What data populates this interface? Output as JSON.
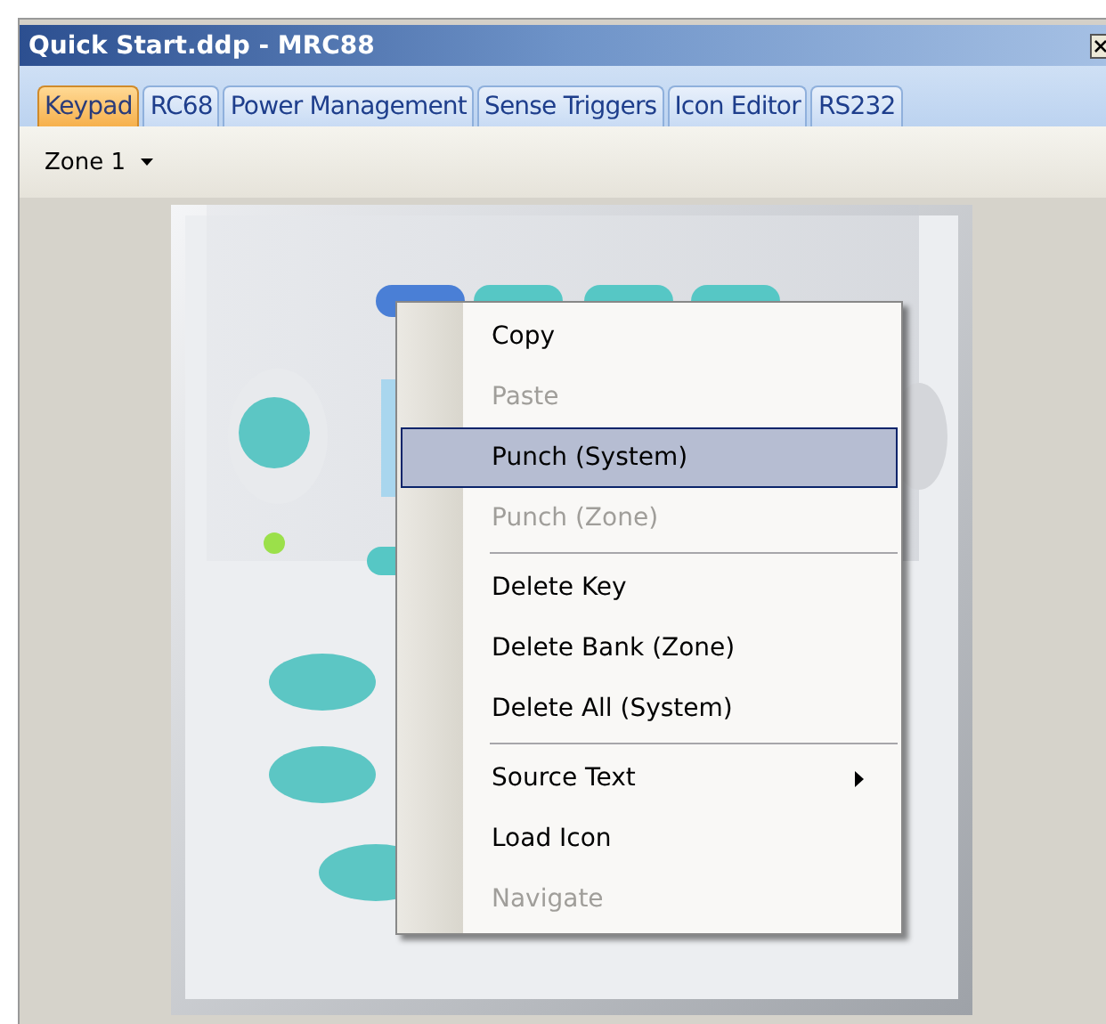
{
  "window": {
    "title": "Quick Start.ddp - MRC88"
  },
  "tabs": [
    {
      "label": "Keypad",
      "selected": true
    },
    {
      "label": "RC68",
      "selected": false
    },
    {
      "label": "Power Management",
      "selected": false
    },
    {
      "label": "Sense Triggers",
      "selected": false
    },
    {
      "label": "Icon Editor",
      "selected": false
    },
    {
      "label": "RS232",
      "selected": false
    }
  ],
  "zone_selector": {
    "value": "Zone 1"
  },
  "context_menu": {
    "items": [
      {
        "kind": "item",
        "label": "Copy",
        "disabled": false,
        "selected": false,
        "submenu": false
      },
      {
        "kind": "item",
        "label": "Paste",
        "disabled": true,
        "selected": false,
        "submenu": false
      },
      {
        "kind": "item",
        "label": "Punch (System)",
        "disabled": false,
        "selected": true,
        "submenu": false
      },
      {
        "kind": "item",
        "label": "Punch (Zone)",
        "disabled": true,
        "selected": false,
        "submenu": false
      },
      {
        "kind": "separator"
      },
      {
        "kind": "item",
        "label": "Delete Key",
        "disabled": false,
        "selected": false,
        "submenu": false
      },
      {
        "kind": "item",
        "label": "Delete Bank (Zone)",
        "disabled": false,
        "selected": false,
        "submenu": false
      },
      {
        "kind": "item",
        "label": "Delete All (System)",
        "disabled": false,
        "selected": false,
        "submenu": false
      },
      {
        "kind": "separator"
      },
      {
        "kind": "item",
        "label": "Source Text",
        "disabled": false,
        "selected": false,
        "submenu": true
      },
      {
        "kind": "item",
        "label": "Load Icon",
        "disabled": false,
        "selected": false,
        "submenu": false
      },
      {
        "kind": "item",
        "label": "Navigate",
        "disabled": true,
        "selected": false,
        "submenu": false
      }
    ]
  }
}
